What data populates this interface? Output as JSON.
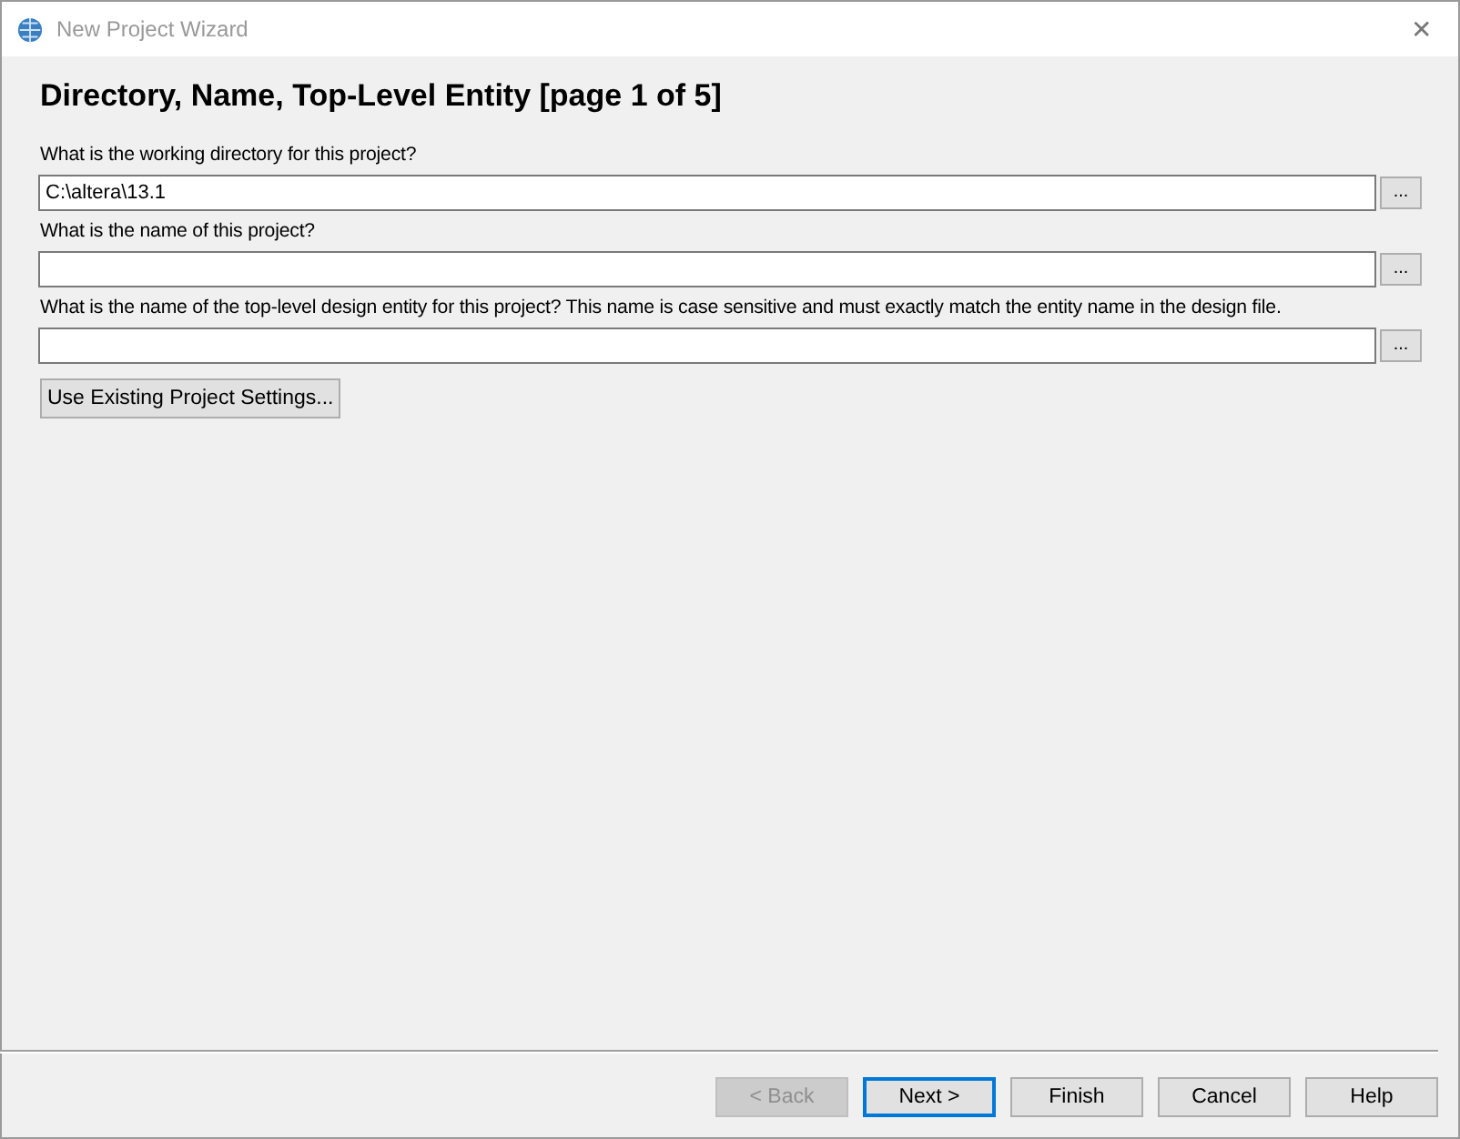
{
  "window": {
    "title": "New Project Wizard",
    "close": "✕"
  },
  "heading": "Directory, Name, Top-Level Entity [page 1 of 5]",
  "fields": [
    {
      "label": "What is the working directory for this project?",
      "value": "C:\\altera\\13.1",
      "browse": "..."
    },
    {
      "label": "What is the name of this project?",
      "browse": "..."
    },
    {
      "label": "What is the name of the top-level design entity for this project? This name is case sensitive and must exactly match the entity name in the design file.",
      "browse": "..."
    }
  ],
  "settings_button": "Use Existing Project Settings...",
  "buttons": [
    {
      "label": "< Back",
      "disabled": true,
      "default": false
    },
    {
      "label": "Next >",
      "disabled": false,
      "default": true
    },
    {
      "label": "Finish",
      "disabled": false,
      "default": false
    },
    {
      "label": "Cancel",
      "disabled": false,
      "default": false
    },
    {
      "label": "Help",
      "disabled": false,
      "default": false
    }
  ]
}
